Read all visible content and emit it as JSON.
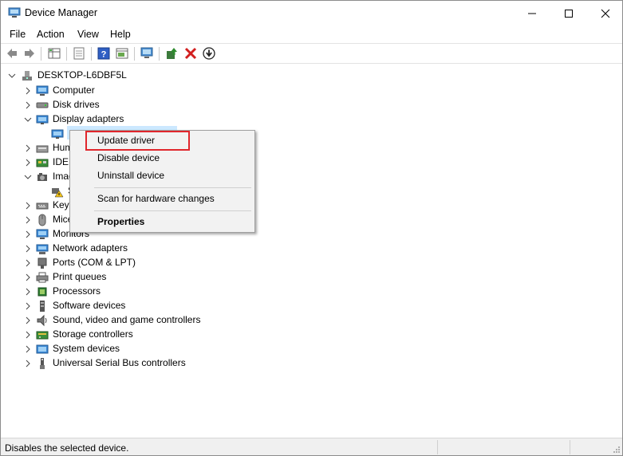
{
  "window": {
    "title": "Device Manager"
  },
  "menubar": {
    "items": [
      "File",
      "Action",
      "View",
      "Help"
    ]
  },
  "toolbar": {
    "buttons": [
      "back-icon",
      "forward-icon",
      "properties-grid-icon",
      "show-hidden-icon",
      "help-icon",
      "driver-details-icon",
      "monitor-icon",
      "update-driver-icon",
      "uninstall-icon",
      "download-icon"
    ]
  },
  "tree": {
    "root": "DESKTOP-L6DBF5L",
    "items": [
      {
        "label": "Computer",
        "icon": "computer-icon"
      },
      {
        "label": "Disk drives",
        "icon": "disk-drive-icon"
      },
      {
        "label": "Display adapters",
        "icon": "display-adapter-icon",
        "expanded": true
      },
      {
        "label": "",
        "icon": "display-adapter-icon",
        "child": true
      },
      {
        "label": "Hum",
        "icon": "hid-icon"
      },
      {
        "label": "IDE A",
        "icon": "ide-icon"
      },
      {
        "label": "Imag",
        "icon": "imaging-icon",
        "expanded": true
      },
      {
        "label": "S",
        "icon": "warning-camera-icon",
        "child": true
      },
      {
        "label": "Keyb",
        "icon": "keyboard-icon"
      },
      {
        "label": "Mice",
        "icon": "mouse-icon"
      },
      {
        "label": "Monitors",
        "icon": "monitor-icon"
      },
      {
        "label": "Network adapters",
        "icon": "network-adapter-icon"
      },
      {
        "label": "Ports (COM & LPT)",
        "icon": "port-icon"
      },
      {
        "label": "Print queues",
        "icon": "printer-icon"
      },
      {
        "label": "Processors",
        "icon": "processor-icon"
      },
      {
        "label": "Software devices",
        "icon": "software-device-icon"
      },
      {
        "label": "Sound, video and game controllers",
        "icon": "speaker-icon"
      },
      {
        "label": "Storage controllers",
        "icon": "storage-controller-icon"
      },
      {
        "label": "System devices",
        "icon": "system-device-icon"
      },
      {
        "label": "Universal Serial Bus controllers",
        "icon": "usb-icon"
      }
    ]
  },
  "context_menu": {
    "update": "Update driver",
    "disable": "Disable device",
    "uninstall": "Uninstall device",
    "scan": "Scan for hardware changes",
    "properties": "Properties",
    "highlight_color": "#e0262c"
  },
  "statusbar": {
    "text": "Disables the selected device."
  },
  "colors": {
    "selection": "#cce8ff",
    "menu_bg": "#f2f2f2",
    "status_bg": "#f0f0f0"
  }
}
